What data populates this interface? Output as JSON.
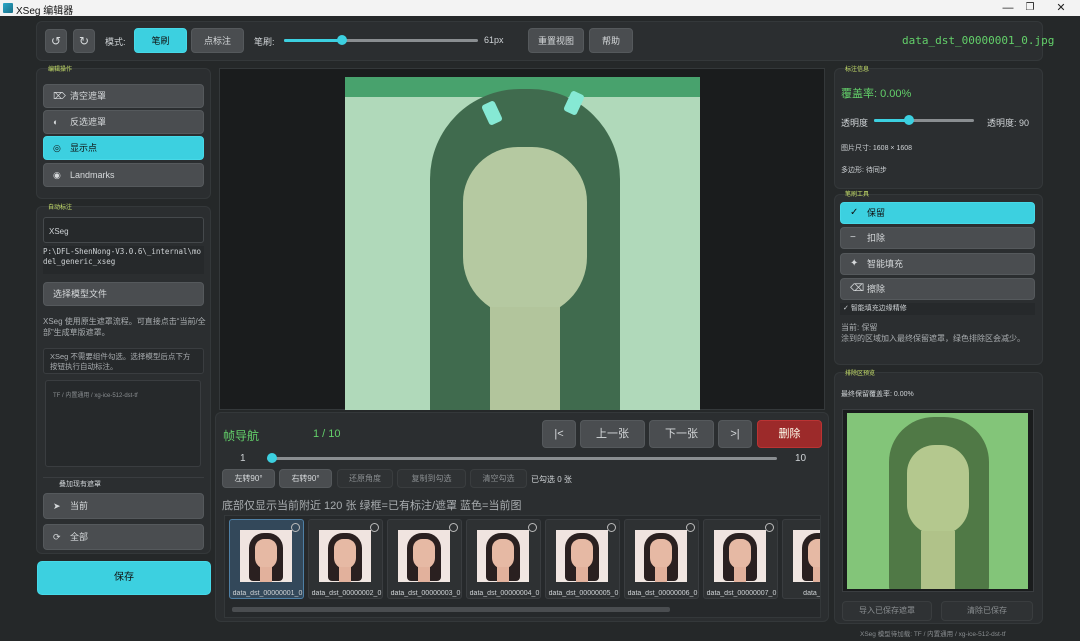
{
  "window": {
    "title": "XSeg 编辑器"
  },
  "toolbar": {
    "mode_label": "模式:",
    "brush_mode": "笔刷",
    "point_mode": "点标注",
    "brush_label": "笔刷:",
    "brush_size": "61px",
    "brush_level": 0.3,
    "reset_view": "重置视图",
    "help": "帮助",
    "filename": "data_dst_00000001_0.jpg"
  },
  "edit_ops": {
    "section_title": "编辑操作",
    "items": [
      {
        "label": "清空遮罩",
        "icon": "eraser-icon",
        "glyph": "⌦"
      },
      {
        "label": "反选遮罩",
        "icon": "invert-icon",
        "glyph": "◐"
      },
      {
        "label": "显示点",
        "icon": "target-icon",
        "glyph": "◎"
      },
      {
        "label": "Landmarks",
        "icon": "eye-icon",
        "glyph": "◉"
      }
    ]
  },
  "auto_label": {
    "section_title": "自动标注",
    "model_name": "XSeg",
    "model_path": "P:\\DFL-ShenNong-V3.0.6\\_internal\\model_generic_xseg",
    "choose_model": "选择模型文件",
    "info_text": "XSeg 使用原生遮罩流程。可直接点击“当前/全部”生成草版遮罩。",
    "hint_text": "XSeg 不需要组件勾选。选择模型后点下方按钮执行自动标注。",
    "log_text": "TF / 内置通用 / xg-ice-512-dst-tf",
    "overlay_label": "叠加现有遮罩",
    "current": "当前",
    "all": "全部",
    "save": "保存"
  },
  "nav": {
    "title": "帧导航",
    "counter": "1 / 10",
    "first": "|<",
    "prev": "上一张",
    "next": "下一张",
    "last": ">|",
    "delete": "删除",
    "slider_min": "1",
    "slider_max": "10",
    "position": 0.0,
    "rotate_left": "左转90°",
    "rotate_right": "右转90°",
    "restore_angle": "还原角度",
    "copy_to_checked": "复制到勾选",
    "clear_checked": "清空勾选",
    "checked_count": "已勾选 0 张",
    "strip_info": "底部仅显示当前附近 120 张  绿框=已有标注/遮罩  蓝色=当前图"
  },
  "thumbnails": [
    {
      "label": "data_dst_00000001_0",
      "current": true
    },
    {
      "label": "data_dst_00000002_0",
      "current": false
    },
    {
      "label": "data_dst_00000003_0",
      "current": false
    },
    {
      "label": "data_dst_00000004_0",
      "current": false
    },
    {
      "label": "data_dst_00000005_0",
      "current": false
    },
    {
      "label": "data_dst_00000006_0",
      "current": false
    },
    {
      "label": "data_dst_00000007_0",
      "current": false
    },
    {
      "label": "data_dst_0",
      "current": false
    }
  ],
  "annotation_info": {
    "section_title": "标注信息",
    "coverage": "覆盖率: 0.00%",
    "opacity_label": "透明度",
    "opacity_value": "透明度: 90",
    "opacity_level": 0.35,
    "image_size": "图片尺寸: 1608 × 1608",
    "polygon": "多边形: 待同步"
  },
  "brush_tools": {
    "section_title": "笔刷工具",
    "items": [
      {
        "label": "保留",
        "icon": "check-icon",
        "glyph": "✓"
      },
      {
        "label": "扣除",
        "icon": "minus-icon",
        "glyph": "−"
      },
      {
        "label": "智能填充",
        "icon": "sparkle-icon",
        "glyph": "✦"
      },
      {
        "label": "擦除",
        "icon": "eraser-icon",
        "glyph": "⌫"
      }
    ],
    "refine_label": "智能填充边缘精修",
    "current_desc": "当前: 保留\n涂到的区域加入最终保留遮罩，绿色排除区会减少。"
  },
  "preview": {
    "section_title": "排除区预览",
    "final_coverage": "最终保留覆盖率: 0.00%",
    "import_saved": "导入已保存遮罩",
    "clear_saved": "清除已保存"
  },
  "status": {
    "text": "XSeg 模型待加载: TF / 内置通用 / xg-ice-512-dst-tf"
  },
  "colors": {
    "accent": "#3cd0e0",
    "delete": "#9c2a2a",
    "mask_tint": "#7fe0a0",
    "section": "#c9e26b"
  }
}
